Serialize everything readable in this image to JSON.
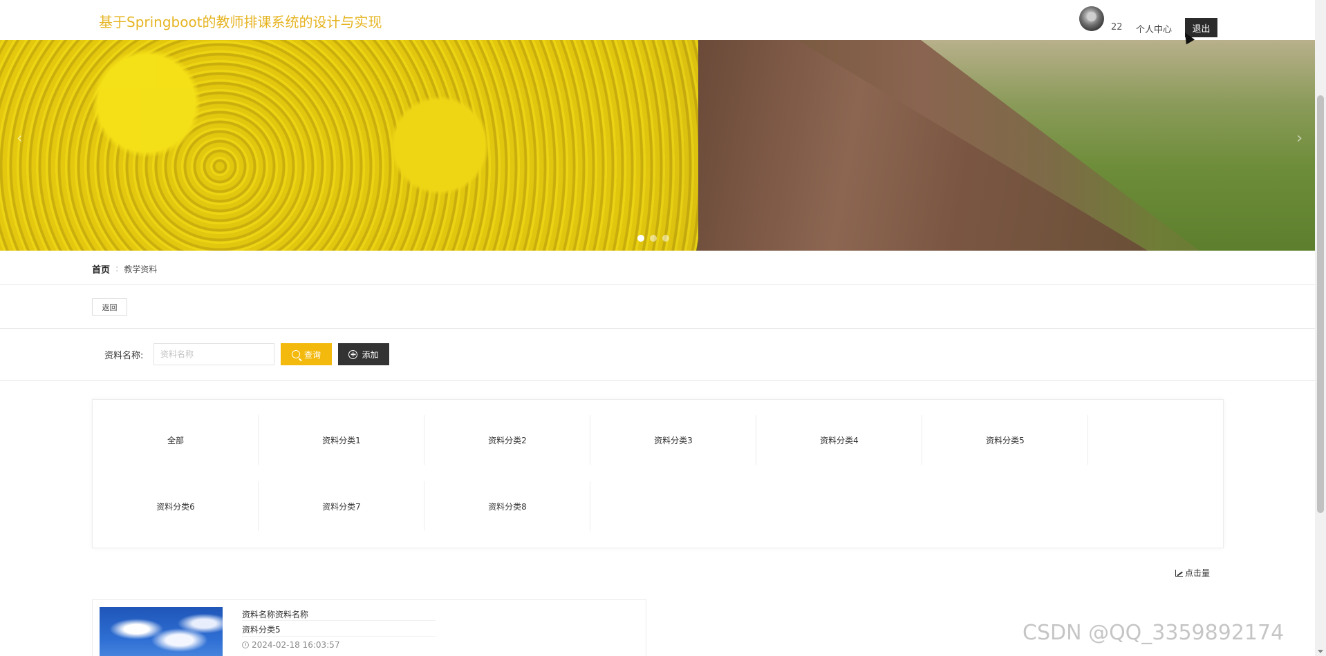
{
  "header": {
    "title": "基于Springboot的教师排课系统的设计与实现",
    "username": "22",
    "personal_center": "个人中心",
    "logout": "退出"
  },
  "banner": {
    "slides": 3,
    "active_slide": 1
  },
  "breadcrumb": {
    "home": "首页",
    "separator": ":",
    "current": "教学资料"
  },
  "back_button": "返回",
  "search": {
    "label": "资料名称:",
    "placeholder": "资料名称",
    "query_button": "查询",
    "add_button": "添加"
  },
  "categories": [
    "全部",
    "资料分类1",
    "资料分类2",
    "资料分类3",
    "资料分类4",
    "资料分类5",
    "资料分类6",
    "资料分类7",
    "资料分类8"
  ],
  "sort": {
    "click_count": "点击量"
  },
  "items": [
    {
      "name": "资料名称资料名称",
      "category": "资料分类5",
      "time": "2024-02-18 16:03:57"
    }
  ],
  "watermark": "CSDN @QQ_3359892174",
  "colors": {
    "accent": "#f3b90c",
    "title": "#e6b422",
    "dark_button": "#333333"
  }
}
